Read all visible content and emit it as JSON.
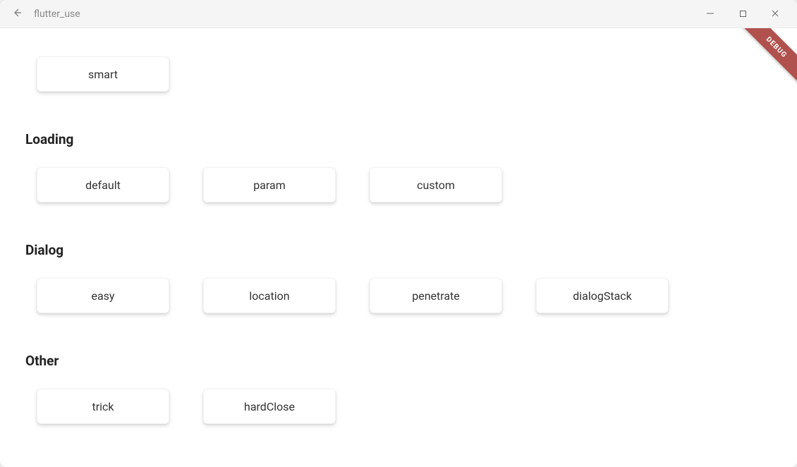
{
  "window": {
    "title": "flutter_use"
  },
  "debug_label": "DEBUG",
  "sections": [
    {
      "title": "",
      "buttons": [
        {
          "label": "smart"
        }
      ]
    },
    {
      "title": "Loading",
      "buttons": [
        {
          "label": "default"
        },
        {
          "label": "param"
        },
        {
          "label": "custom"
        }
      ]
    },
    {
      "title": "Dialog",
      "buttons": [
        {
          "label": "easy"
        },
        {
          "label": "location"
        },
        {
          "label": "penetrate"
        },
        {
          "label": "dialogStack"
        }
      ]
    },
    {
      "title": "Other",
      "buttons": [
        {
          "label": "trick"
        },
        {
          "label": "hardClose"
        }
      ]
    }
  ]
}
